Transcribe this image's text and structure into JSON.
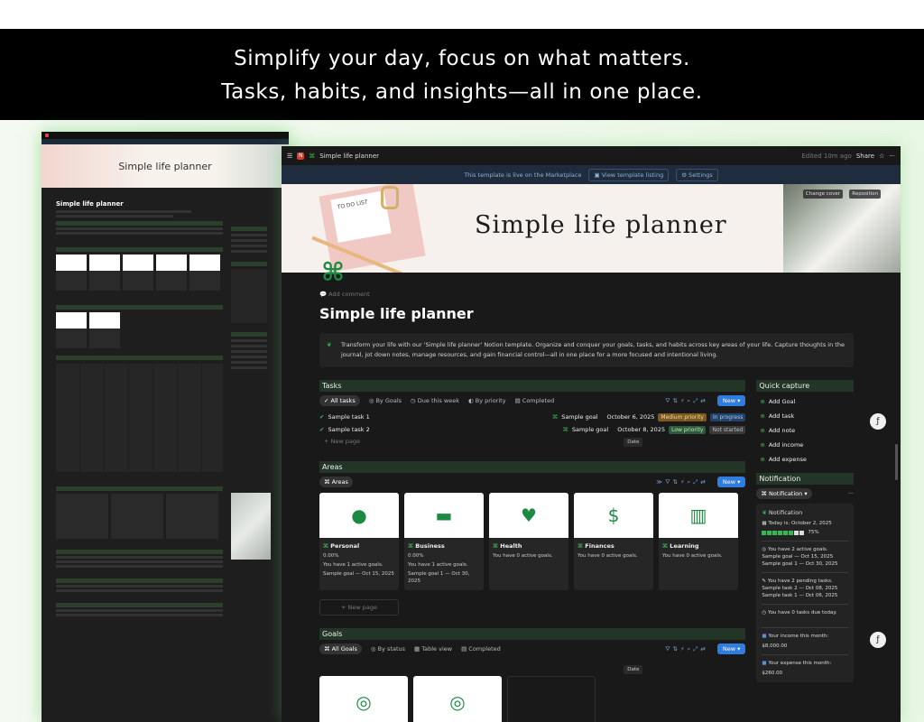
{
  "banner": {
    "line1": "Simplify your day, focus on what matters.",
    "line2": "Tasks, habits, and insights—all in one place."
  },
  "back": {
    "title": "Simple life planner"
  },
  "window": {
    "page_path": "Simple life planner",
    "edited": "Edited 10m ago",
    "share": "Share"
  },
  "marketplace": {
    "text": "This template is live on the Marketplace",
    "listing": "View template listing",
    "settings": "Settings"
  },
  "cover": {
    "title": "Simple life planner",
    "change": "Change cover",
    "reposition": "Reposition",
    "note_text": "TO DO LIST"
  },
  "page": {
    "add_comment": "Add comment",
    "title": "Simple life planner",
    "callout": "Transform your life with our 'Simple life planner' Notion template. Organize and conquer your goals, tasks, and habits across key areas of your life. Capture thoughts in the journal, jot down notes, manage resources, and gain financial control—all in one place for a more focused and intentional living."
  },
  "tasks": {
    "header": "Tasks",
    "tabs": [
      "All tasks",
      "By Goals",
      "Due this week",
      "By priority",
      "Completed"
    ],
    "new": "New",
    "new_page": "New page",
    "date_btn": "Date",
    "rows": [
      {
        "name": "Sample task 1",
        "goal": "Sample goal",
        "date": "October 6, 2025",
        "priority": "Medium priority",
        "status": "In progress"
      },
      {
        "name": "Sample task 2",
        "goal": "Sample goal",
        "date": "October 8, 2025",
        "priority": "Low priority",
        "status": "Not started"
      }
    ]
  },
  "areas": {
    "header": "Areas",
    "tab": "Areas",
    "new": "New",
    "new_page": "New page",
    "cards": [
      {
        "name": "Personal",
        "icon": "person-icon",
        "pct": "0.00%",
        "l1": "You have 1 active goals.",
        "l2": "Sample goal — Oct 15, 2025"
      },
      {
        "name": "Business",
        "icon": "briefcase-icon",
        "pct": "0.00%",
        "l1": "You have 1 active goals.",
        "l2": "Sample goal 1 — Oct 30, 2025"
      },
      {
        "name": "Health",
        "icon": "heart-pulse-icon",
        "pct": "",
        "l1": "You have 0 active goals.",
        "l2": ""
      },
      {
        "name": "Finances",
        "icon": "money-bag-icon",
        "pct": "",
        "l1": "You have 0 active goals.",
        "l2": ""
      },
      {
        "name": "Learning",
        "icon": "book-icon",
        "pct": "",
        "l1": "You have 0 active goals.",
        "l2": ""
      }
    ]
  },
  "goals": {
    "header": "Goals",
    "tabs": [
      "All Goals",
      "By status",
      "Table view",
      "Completed"
    ],
    "new": "New",
    "date_btn": "Date"
  },
  "quick": {
    "header": "Quick capture",
    "items": [
      "Add Goal",
      "Add task",
      "Add note",
      "Add income",
      "Add expense"
    ]
  },
  "notification": {
    "header": "Notification",
    "tab": "Notification",
    "title": "Notification",
    "today": "Today is: October 2, 2025",
    "pct": "75%",
    "goals1": "You have 2 active goals.",
    "goals2": "Sample goal — Oct 15, 2025",
    "goals3": "Sample goal 1 — Oct 30, 2025",
    "tasks1": "You have 2 pending tasks.",
    "tasks2": "Sample task 2 — Oct 08, 2025",
    "tasks3": "Sample task 1 — Oct 06, 2025",
    "due": "You have 0 tasks due today.",
    "income_l": "Your income this month:",
    "income_v": "$8,000.00",
    "expense_l": "Your expense this month:",
    "expense_v": "$260.00"
  }
}
